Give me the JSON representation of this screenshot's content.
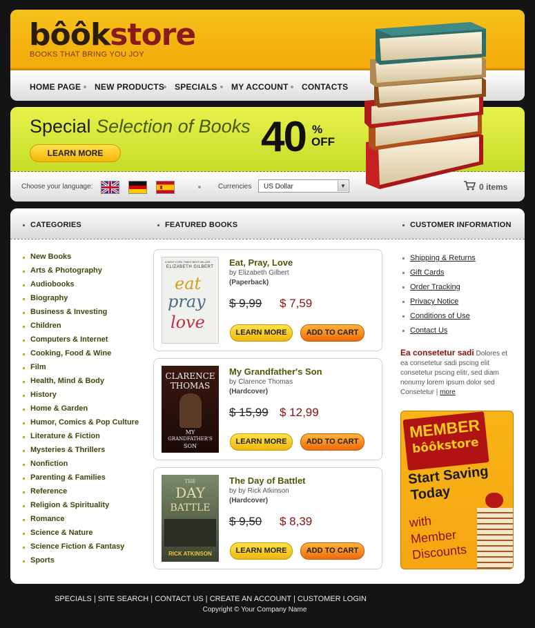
{
  "logo": {
    "brand_a": "bôôk",
    "brand_b": "store",
    "tagline": "BOOKS THAT BRING YOU JOY"
  },
  "nav": [
    "HOME PAGE",
    "NEW PRODUCTS",
    "SPECIALS",
    "MY ACCOUNT",
    "CONTACTS"
  ],
  "banner": {
    "title_a": "Special",
    "title_b": "Selection of Books",
    "button": "LEARN MORE",
    "discount": "40",
    "pct": "%",
    "off": "OFF"
  },
  "langbar": {
    "label": "Choose your language:",
    "languages": [
      "English",
      "German",
      "Spanish"
    ],
    "currency_label": "Currencies",
    "currency_value": "US Dollar",
    "cart": "0 items"
  },
  "columns": {
    "categories": "CATEGORIES",
    "featured": "FEATURED BOOKS",
    "customer": "CUSTOMER INFORMATION"
  },
  "categories": [
    "New Books",
    "Arts & Photography",
    "Audiobooks",
    "Biography",
    "Business & Investing",
    "Children",
    "Computers & Internet",
    "Cooking, Food & Wine",
    "Film",
    "Health, Mind & Body",
    "History",
    "Home & Garden",
    "Humor, Comics & Pop Culture",
    "Literature & Fiction",
    "Mysteries & Thrillers",
    "Nonfiction",
    "Parenting & Families",
    "Reference",
    "Religion & Spirituality",
    "Romance",
    "Science & Nature",
    "Science Fiction & Fantasy",
    "Sports"
  ],
  "books": [
    {
      "title": "Eat, Pray, Love",
      "author": "by Elizabeth Gilbert",
      "format": "(Paperback)",
      "old_price": "$ 9,99",
      "new_price": "$ 7,59",
      "cover_top": "A NEW YORK TIMES BESTSELLER",
      "cover_author": "ELIZABETH GILBERT",
      "cover_w1": "eat",
      "cover_w2": "pray",
      "cover_w3": "love"
    },
    {
      "title": "My Grandfather's Son",
      "author": "by Clarence Thomas",
      "format": "(Hardcover)",
      "old_price": "$ 15,99",
      "new_price": "$ 12,99",
      "cover_a1": "CLARENCE",
      "cover_a2": "THOMAS",
      "cover_t1": "MY",
      "cover_t2": "GRANDFATHER'S",
      "cover_t3": "SON"
    },
    {
      "title": "The Day of Battlet",
      "author": "by by Rick Atkinson",
      "format": "(Hardcover)",
      "old_price": "$ 9,50",
      "new_price": "$ 8,39",
      "cover_t1": "THE",
      "cover_t2": "DAY",
      "cover_t3": "BATTLE",
      "cover_author": "RICK ATKINSON"
    }
  ],
  "buttons": {
    "learn": "LEARN MORE",
    "cart": "ADD TO CART"
  },
  "customer_info": [
    "Shipping & Returns",
    "Gift Cards",
    "Order Tracking",
    "Privacy Notice",
    "Conditions of Use",
    "Contact Us"
  ],
  "blurb": {
    "heading": "Ea consetetur sadi",
    "body": "Dolores et ea consetetur sadi pscing elit consetetur pscing elitr, sed diam nonumy lorem ipsum dolor sed Consetetur",
    "more": "more"
  },
  "promo": {
    "line1": "MEMBER",
    "brand": "bôôkstore",
    "line2": "Start Saving",
    "line3": "Today",
    "line4": "with",
    "line5": "Member",
    "line6": "Discounts"
  },
  "footer": {
    "links": [
      "SPECIALS",
      "SITE SEARCH",
      "CONTACT US",
      "CREATE AN ACCOUNT",
      "CUSTOMER LOGIN"
    ],
    "copyright": "Copyright © Your Company Name"
  },
  "colors": {
    "accent_yellow": "#f6c21c",
    "accent_green": "#c4dc2a",
    "price_red": "#8a1010",
    "title_green": "#4a5a0a"
  }
}
